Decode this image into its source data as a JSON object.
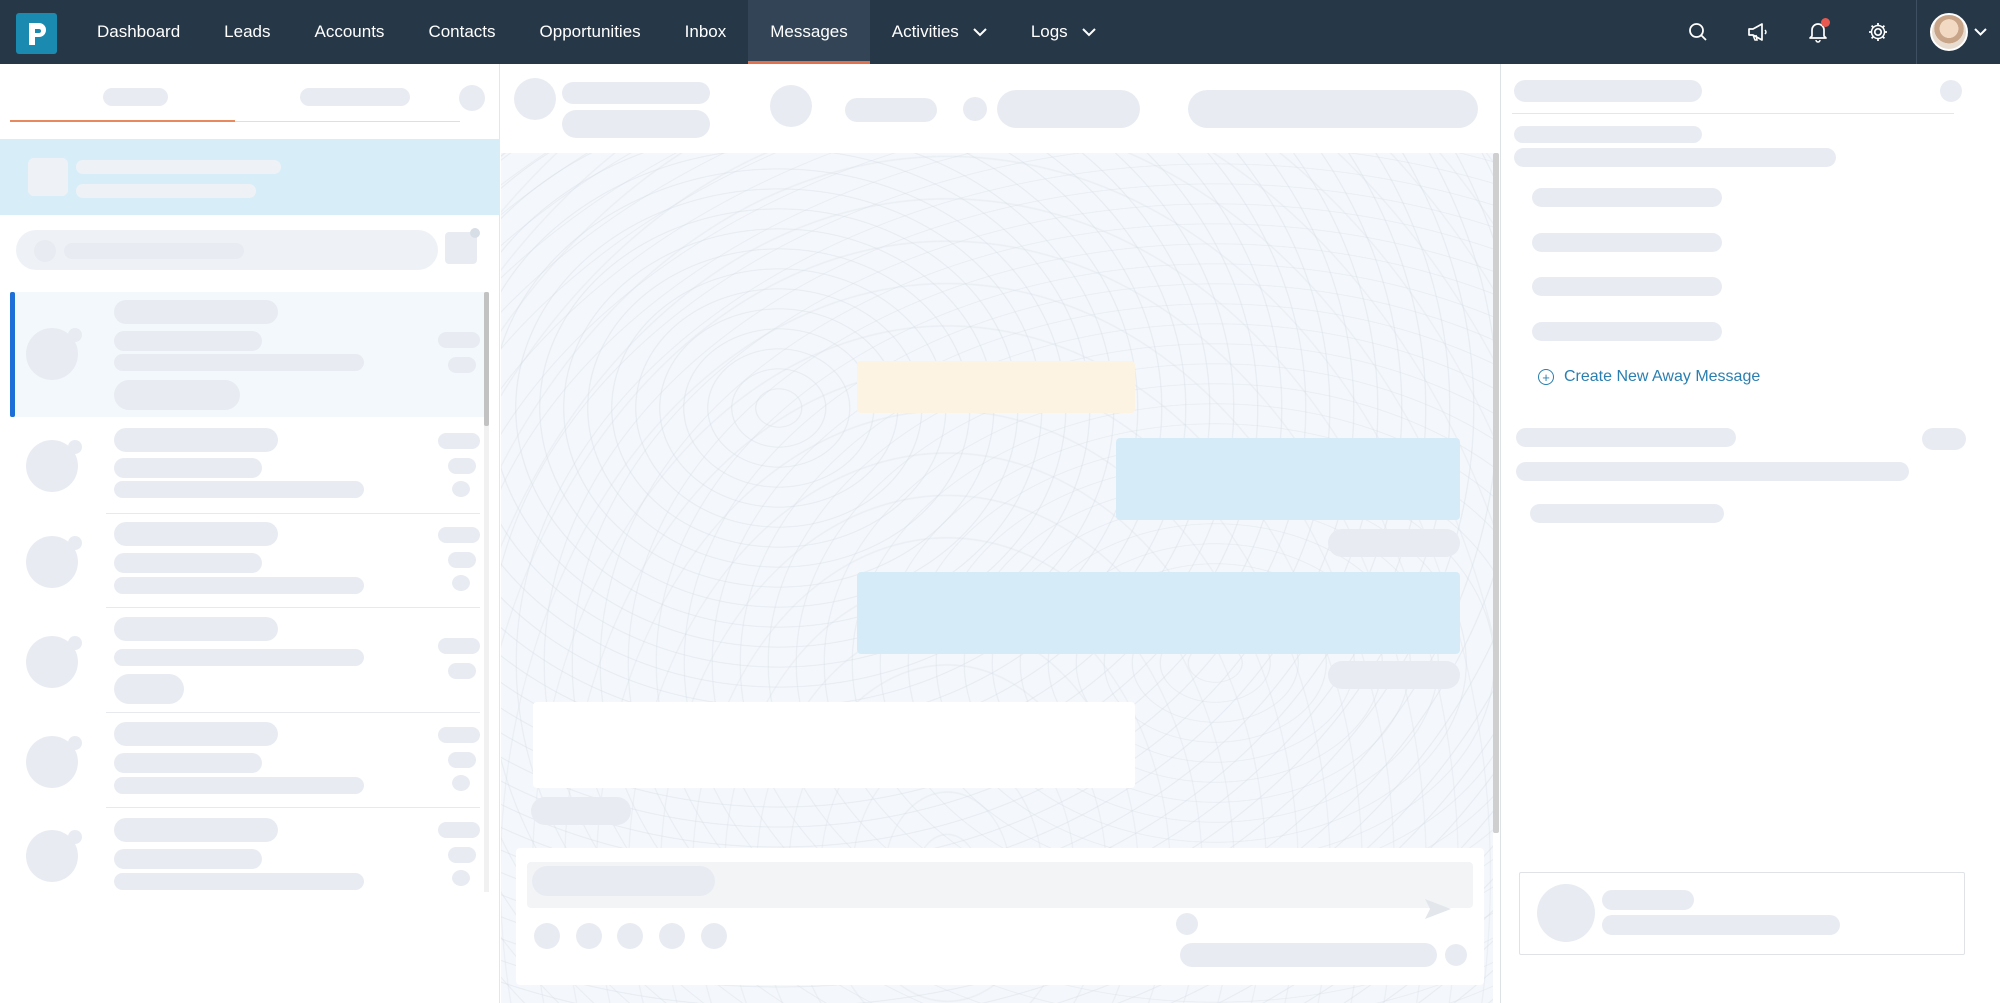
{
  "nav": {
    "items": [
      {
        "label": "Dashboard"
      },
      {
        "label": "Leads"
      },
      {
        "label": "Accounts"
      },
      {
        "label": "Contacts"
      },
      {
        "label": "Opportunities"
      },
      {
        "label": "Inbox"
      },
      {
        "label": "Messages",
        "active": true
      },
      {
        "label": "Activities",
        "dropdown": true
      },
      {
        "label": "Logs",
        "dropdown": true
      }
    ],
    "right_icons": [
      "search-icon",
      "megaphone-icon",
      "bell-icon",
      "gear-icon"
    ]
  },
  "right_panel": {
    "create_away_message": "Create New Away Message"
  },
  "colors": {
    "nav_bg": "#263747",
    "brand": "#1b8ab0",
    "active_underline": "#e0714f",
    "link": "#2a7fb0",
    "skeleton": "#e8ecf2",
    "bubble_outgoing": "#d5ecf8",
    "bubble_system": "#fdf3e2"
  },
  "state": {
    "loading": true
  }
}
